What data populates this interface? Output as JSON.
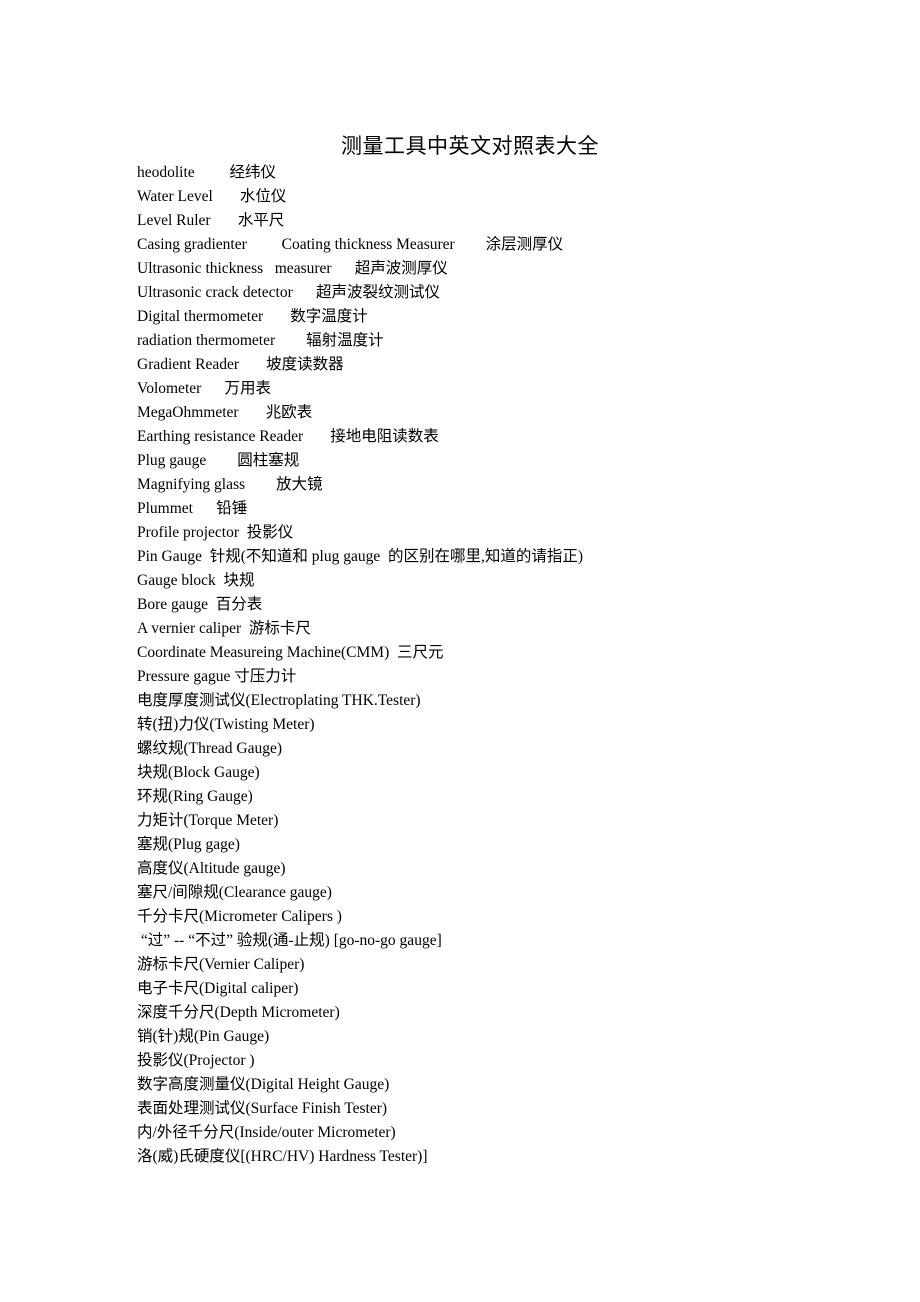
{
  "document": {
    "title": "测量工具中英文对照表大全",
    "lines": [
      "heodolite         经纬仪",
      "Water Level       水位仪",
      "Level Ruler       水平尺",
      "Casing gradienter         Coating thickness Measurer        涂层测厚仪",
      "Ultrasonic thickness   measurer      超声波测厚仪",
      "Ultrasonic crack detector      超声波裂纹测试仪",
      "Digital thermometer       数字温度计",
      "radiation thermometer        辐射温度计",
      "Gradient Reader       坡度读数器",
      "Volometer      万用表",
      "MegaOhmmeter       兆欧表",
      "Earthing resistance Reader       接地电阻读数表",
      "Plug gauge        圆柱塞规",
      "Magnifying glass        放大镜",
      "Plummet      铅锤",
      "Profile projector  投影仪",
      "Pin Gauge  针规(不知道和 plug gauge  的区别在哪里,知道的请指正)",
      "Gauge block  块规",
      "Bore gauge  百分表",
      "A vernier caliper  游标卡尺",
      "Coordinate Measureing Machine(CMM)  三尺元",
      "Pressure gague 寸压力计",
      "电度厚度测试仪(Electroplating THK.Tester)",
      "转(扭)力仪(Twisting Meter)",
      "螺纹规(Thread Gauge)",
      "块规(Block Gauge)",
      "环规(Ring Gauge)",
      "力矩计(Torque Meter)",
      "塞规(Plug gage)",
      "高度仪(Altitude gauge)",
      "塞尺/间隙规(Clearance gauge)",
      "千分卡尺(Micrometer Calipers )",
      " “过” -- “不过” 验规(通-止规) [go-no-go gauge]",
      "游标卡尺(Vernier Caliper)",
      "电子卡尺(Digital caliper)",
      "深度千分尺(Depth Micrometer)",
      "销(针)规(Pin Gauge)",
      "投影仪(Projector )",
      "数字高度测量仪(Digital Height Gauge)",
      "表面处理测试仪(Surface Finish Tester)",
      "内/外径千分尺(Inside/outer Micrometer)",
      "洛(威)氏硬度仪[(HRC/HV) Hardness Tester)]"
    ]
  }
}
